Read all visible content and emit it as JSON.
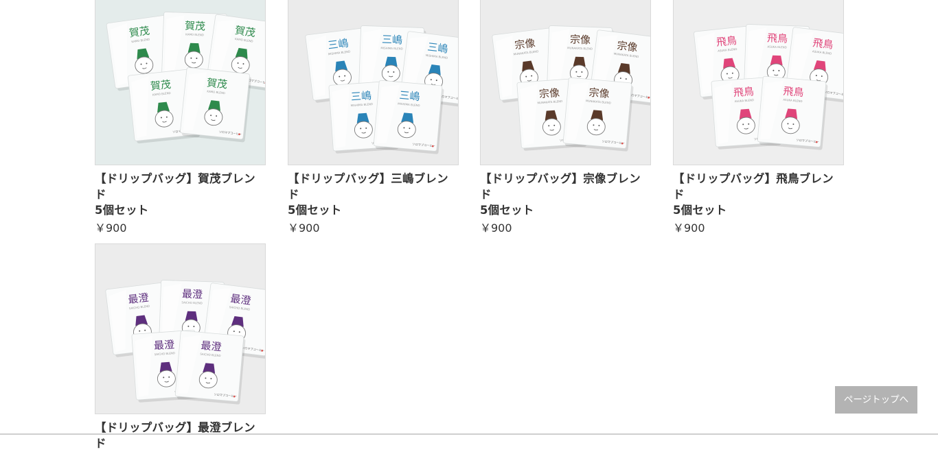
{
  "products": [
    {
      "name": "【ドリップバッグ】賀茂ブレンド\n5個セット",
      "price": "￥900",
      "package_label": "賀茂",
      "package_sublabel": "KAMO BLEND",
      "brand_mark": "ソロマブコーヒー",
      "accent_color": "#2e8a4c",
      "background_color": "#e4eceb"
    },
    {
      "name": "【ドリップバッグ】三嶋ブレンド\n5個セット",
      "price": "￥900",
      "package_label": "三嶋",
      "package_sublabel": "MISHIMA BLEND",
      "brand_mark": "ソロマブコーヒー",
      "accent_color": "#2a84b8",
      "background_color": "#ebebeb"
    },
    {
      "name": "【ドリップバッグ】宗像ブレンド\n5個セット",
      "price": "￥900",
      "package_label": "宗像",
      "package_sublabel": "MUNAKATA BLEND",
      "brand_mark": "ソロマブコーヒー",
      "accent_color": "#5a3a2a",
      "background_color": "#ececec"
    },
    {
      "name": "【ドリップバッグ】飛鳥ブレンド\n5個セット",
      "price": "￥900",
      "package_label": "飛鳥",
      "package_sublabel": "ASUKA BLEND",
      "brand_mark": "ソロマブコーヒー",
      "accent_color": "#e0457a",
      "background_color": "#eeeeee"
    },
    {
      "name": "【ドリップバッグ】最澄ブレンド",
      "price": "",
      "package_label": "最澄",
      "package_sublabel": "SAICHO BLEND",
      "brand_mark": "ソロマブコーヒー",
      "accent_color": "#5e2f7e",
      "background_color": "#ececec"
    }
  ],
  "page_top_label": "ページトップへ"
}
